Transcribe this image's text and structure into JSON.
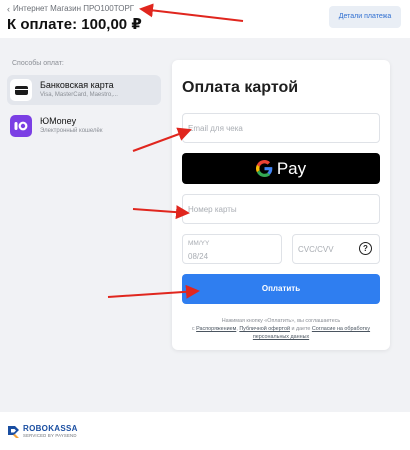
{
  "header": {
    "back_label": "Интернет Магазин ПРО100ТОРГ",
    "amount_label": "К оплате: 100,00 ₽",
    "details_button": "Детали платежа"
  },
  "sidebar": {
    "title": "Способы оплат:",
    "methods": [
      {
        "name": "Банковская карта",
        "subtitle": "Visa, MasterCard, Maestro,...",
        "icon": "bank-card-icon",
        "selected": true
      },
      {
        "name": "ЮMoney",
        "subtitle": "Электронный кошелёк",
        "icon": "yoomoney-icon",
        "selected": false
      }
    ]
  },
  "card_form": {
    "title": "Оплата картой",
    "email_placeholder": "Email для чека",
    "gpay_label": "Pay",
    "card_number_placeholder": "Номер карты",
    "expiry_label": "MM/YY",
    "expiry_placeholder": "08/24",
    "cvc_placeholder": "CVC/CVV",
    "help_icon": "?",
    "pay_button": "Оплатить",
    "consent": {
      "text_1": "Нажимая кнопку «Оплатить», вы соглашаетесь",
      "text_2": "с",
      "link_1": "Распоряжением",
      "text_3": ",",
      "link_2": "Публичной офертой",
      "text_4": "и даете",
      "link_3": "Согласие на обработку персональных данных"
    }
  },
  "footer": {
    "logo_main": "ROBOKASSA",
    "logo_sub": "SERVICED BY PAYSEND"
  },
  "colors": {
    "accent": "#2f7ef0",
    "yoomoney": "#7b3fe4",
    "annotation_arrow": "#e0261e",
    "page_bg": "#f1f2f5"
  }
}
